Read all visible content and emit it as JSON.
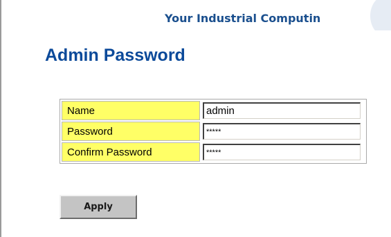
{
  "header": {
    "tagline": "Your Industrial Computin"
  },
  "page": {
    "title": "Admin Password"
  },
  "form": {
    "rows": [
      {
        "label": "Name",
        "value": "admin"
      },
      {
        "label": "Password",
        "value": "*****"
      },
      {
        "label": "Confirm Password",
        "value": "*****"
      }
    ],
    "apply_label": "Apply"
  },
  "colors": {
    "title": "#0c4a9a",
    "tagline": "#1a4f8e",
    "label_background": "#ffff66",
    "button_background": "#c4c4c4"
  }
}
